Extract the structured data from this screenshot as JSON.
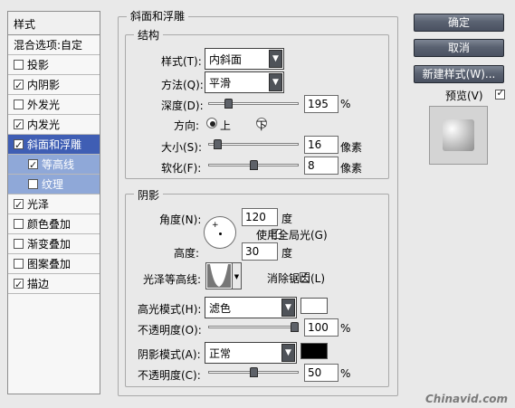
{
  "left": {
    "header": "样式",
    "items": [
      {
        "label": "混合选项:自定",
        "checkbox": false,
        "checked": false,
        "state": "normal"
      },
      {
        "label": "投影",
        "checkbox": true,
        "checked": false,
        "state": "normal"
      },
      {
        "label": "内阴影",
        "checkbox": true,
        "checked": true,
        "state": "normal"
      },
      {
        "label": "外发光",
        "checkbox": true,
        "checked": false,
        "state": "normal"
      },
      {
        "label": "内发光",
        "checkbox": true,
        "checked": true,
        "state": "normal"
      },
      {
        "label": "斜面和浮雕",
        "checkbox": true,
        "checked": true,
        "state": "selected"
      },
      {
        "label": "等高线",
        "checkbox": true,
        "checked": true,
        "state": "sub"
      },
      {
        "label": "纹理",
        "checkbox": true,
        "checked": false,
        "state": "sub"
      },
      {
        "label": "光泽",
        "checkbox": true,
        "checked": true,
        "state": "normal"
      },
      {
        "label": "颜色叠加",
        "checkbox": true,
        "checked": false,
        "state": "normal"
      },
      {
        "label": "渐变叠加",
        "checkbox": true,
        "checked": false,
        "state": "normal"
      },
      {
        "label": "图案叠加",
        "checkbox": true,
        "checked": false,
        "state": "normal"
      },
      {
        "label": "描边",
        "checkbox": true,
        "checked": true,
        "state": "normal"
      }
    ]
  },
  "bevel": {
    "title": "斜面和浮雕",
    "structure": {
      "title": "结构",
      "style_label": "样式(T):",
      "style_value": "内斜面",
      "technique_label": "方法(Q):",
      "technique_value": "平滑",
      "depth_label": "深度(D):",
      "depth_value": "195",
      "depth_unit": "%",
      "depth_fraction": 0.195,
      "direction_label": "方向:",
      "dir_up": "上",
      "dir_down": "下",
      "size_label": "大小(S):",
      "size_value": "16",
      "size_unit": "像素",
      "size_fraction": 0.064,
      "soften_label": "软化(F):",
      "soften_value": "8",
      "soften_unit": "像素",
      "soften_fraction": 0.5
    },
    "shading": {
      "title": "阴影",
      "angle_label": "角度(N):",
      "angle_value": "120",
      "angle_unit": "度",
      "global_light_label": "使用全局光(G)",
      "altitude_label": "高度:",
      "altitude_value": "30",
      "altitude_unit": "度",
      "gloss_label": "光泽等高线:",
      "antialias_label": "消除锯齿(L)",
      "highlight_label": "高光模式(H):",
      "highlight_mode": "滤色",
      "highlight_color": "#ffffff",
      "hl_opacity_label": "不透明度(O):",
      "hl_opacity_value": "100",
      "hl_opacity_unit": "%",
      "hl_opacity_fraction": 1.0,
      "shadow_label": "阴影模式(A):",
      "shadow_mode": "正常",
      "shadow_color": "#000000",
      "sh_opacity_label": "不透明度(C):",
      "sh_opacity_value": "50",
      "sh_opacity_unit": "%",
      "sh_opacity_fraction": 0.5
    }
  },
  "buttons": {
    "ok": "确定",
    "cancel": "取消",
    "new_style": "新建样式(W)...",
    "preview": "预览(V)"
  },
  "watermark": "Chinavid.com"
}
